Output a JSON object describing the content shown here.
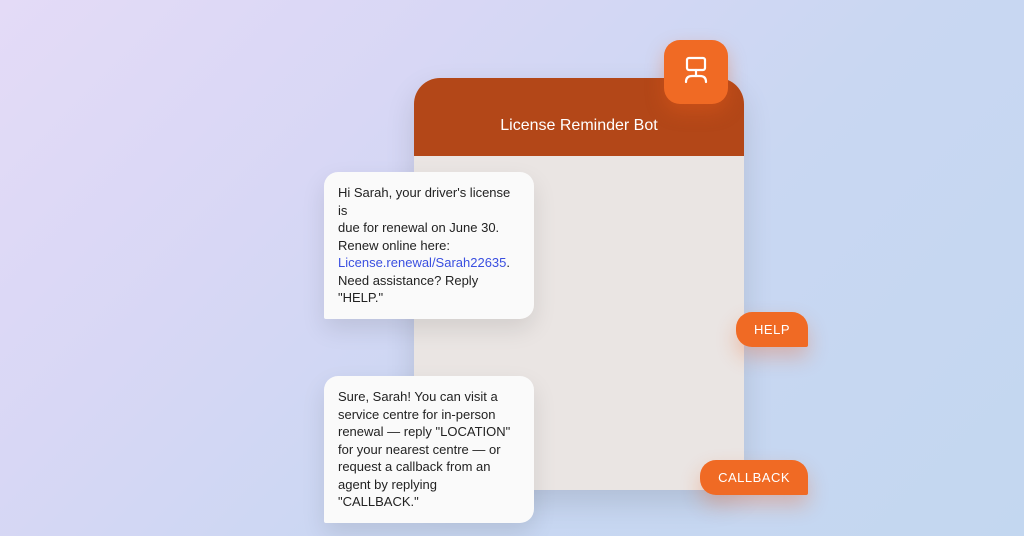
{
  "header": {
    "title": "License Reminder Bot"
  },
  "icons": {
    "bot_badge": "bot-desk-icon"
  },
  "messages": {
    "bot1": {
      "line1": "Hi Sarah, your driver's license is",
      "line2": "due for renewal on June 30.",
      "line3": "Renew online here:",
      "link": "License.renewal/Sarah22635",
      "linkTail": ".",
      "line5": "Need assistance? Reply \"HELP.\""
    },
    "user1": "HELP",
    "bot2": {
      "line1": "Sure, Sarah! You can visit a",
      "line2": "service centre for in-person",
      "line3": "renewal — reply \"LOCATION\"",
      "line4": "for your nearest centre — or",
      "line5": "request a callback from an",
      "line6": "agent by replying \"CALLBACK.\""
    },
    "user2": "CALLBACK"
  },
  "colors": {
    "accent": "#F06A24",
    "headerBg": "#B34718",
    "link": "#3A4FE0"
  }
}
